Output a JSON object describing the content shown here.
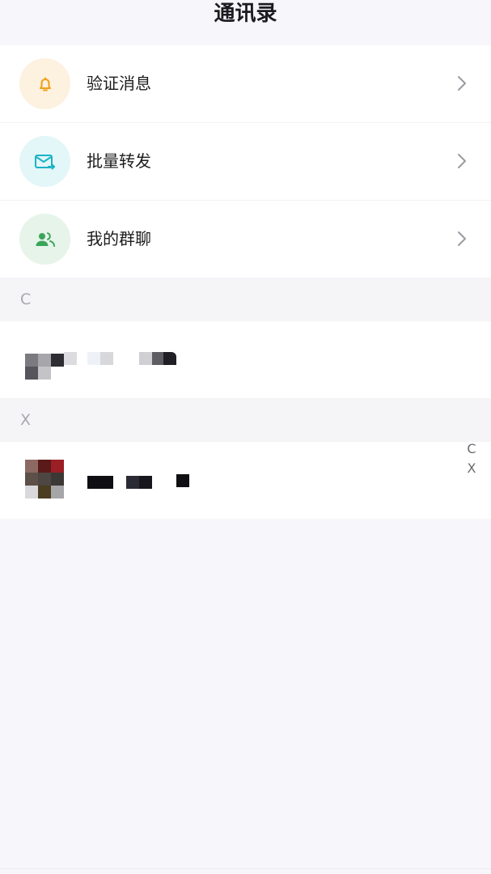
{
  "header": {
    "title": "通讯录"
  },
  "menu": [
    {
      "id": "verify",
      "label": "验证消息",
      "icon": "bell-icon",
      "icon_bg": "#fdf1df",
      "icon_color": "#f0a017"
    },
    {
      "id": "batch",
      "label": "批量转发",
      "icon": "mail-forward-icon",
      "icon_bg": "#e3f6f8",
      "icon_color": "#1ab3c6"
    },
    {
      "id": "groups",
      "label": "我的群聊",
      "icon": "group-icon",
      "icon_bg": "#e6f4ea",
      "icon_color": "#3aa55a"
    }
  ],
  "sections": [
    {
      "letter": "C"
    },
    {
      "letter": "X"
    }
  ],
  "index_bar": [
    "C",
    "X"
  ]
}
